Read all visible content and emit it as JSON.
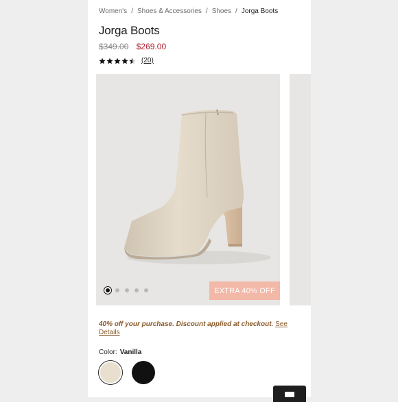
{
  "breadcrumb": {
    "items": [
      "Women's",
      "Shoes & Accessories",
      "Shoes"
    ],
    "current": "Jorga Boots",
    "separator": "/"
  },
  "product": {
    "title": "Jorga Boots",
    "price_original": "$349.00",
    "price_sale": "$269.00",
    "rating": 4.5,
    "rating_max": 5,
    "review_count": "(20)"
  },
  "gallery": {
    "badge": "EXTRA 40% OFF",
    "image_count": 5,
    "active_index": 0
  },
  "promo": {
    "text": "40% off your purchase. Discount applied at checkout.",
    "link": "See Details"
  },
  "color": {
    "label": "Color:",
    "selected": "Vanilla",
    "swatches": [
      {
        "name": "Vanilla",
        "hex": "#e9dfcf"
      },
      {
        "name": "Black",
        "hex": "#111111"
      }
    ]
  },
  "colors": {
    "sale_price": "#b02030",
    "badge_bg": "#f2b8a8",
    "promo_text": "#8a5a2a"
  }
}
